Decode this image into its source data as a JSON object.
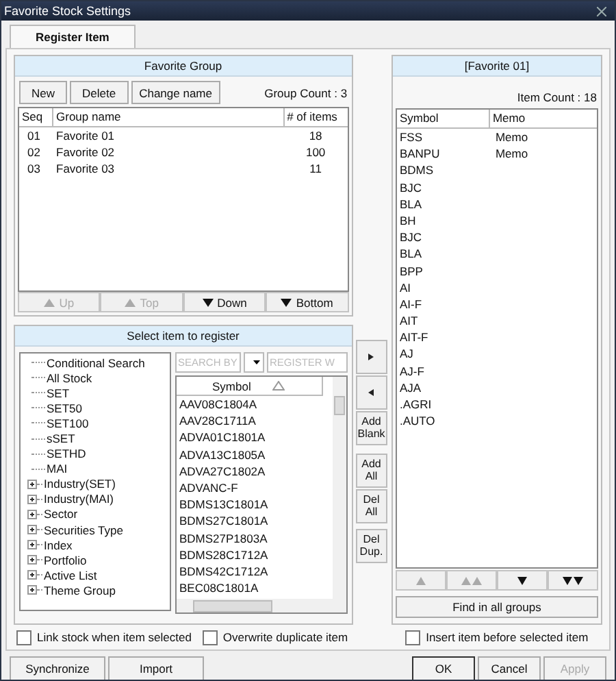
{
  "window": {
    "title": "Favorite Stock Settings"
  },
  "tabs": [
    {
      "label": "Register Item",
      "selected": true
    }
  ],
  "favorite_group": {
    "title": "Favorite Group",
    "buttons": [
      "New",
      "Delete",
      "Change name"
    ],
    "group_count": "Group Count : 3",
    "columns": [
      "Seq",
      "Group name",
      "# of items"
    ],
    "rows": [
      {
        "seq": "01",
        "name": "Favorite 01",
        "items": "18"
      },
      {
        "seq": "02",
        "name": "Favorite 02",
        "items": "100"
      },
      {
        "seq": "03",
        "name": "Favorite 03",
        "items": "11"
      }
    ],
    "move_buttons": [
      {
        "label": "Up",
        "kind": "up",
        "disabled": true
      },
      {
        "label": "Top",
        "kind": "up",
        "disabled": true
      },
      {
        "label": "Down",
        "kind": "down",
        "disabled": false
      },
      {
        "label": "Bottom",
        "kind": "down",
        "disabled": false
      }
    ]
  },
  "select_panel": {
    "title": "Select item to register",
    "tree": [
      {
        "label": "Conditional Search",
        "kind": "leaf"
      },
      {
        "label": "All Stock",
        "kind": "leaf"
      },
      {
        "label": "SET",
        "kind": "leaf"
      },
      {
        "label": "SET50",
        "kind": "leaf"
      },
      {
        "label": "SET100",
        "kind": "leaf"
      },
      {
        "label": "sSET",
        "kind": "leaf"
      },
      {
        "label": "SETHD",
        "kind": "leaf"
      },
      {
        "label": "MAI",
        "kind": "leaf"
      },
      {
        "label": "Industry(SET)",
        "kind": "group",
        "expanded": false
      },
      {
        "label": "Industry(MAI)",
        "kind": "group",
        "expanded": false
      },
      {
        "label": "Sector",
        "kind": "group",
        "expanded": false
      },
      {
        "label": "Securities Type",
        "kind": "group",
        "expanded": false
      },
      {
        "label": "Index",
        "kind": "group",
        "expanded": false
      },
      {
        "label": "Portfolio",
        "kind": "group",
        "expanded": false
      },
      {
        "label": "Active List",
        "kind": "group",
        "expanded": false
      },
      {
        "label": "Theme Group",
        "kind": "group",
        "expanded": false
      }
    ],
    "search_field": {
      "placeholder": "SEARCH BY"
    },
    "register_field": {
      "placeholder": "REGISTER W"
    },
    "symbol_column": "Symbol",
    "symbols": [
      "AAV08C1804A",
      "AAV28C1711A",
      "ADVA01C1801A",
      "ADVA13C1805A",
      "ADVA27C1802A",
      "ADVANC-F",
      "BDMS13C1801A",
      "BDMS27C1801A",
      "BDMS27P1803A",
      "BDMS28C1712A",
      "BDMS42C1712A",
      "BEC08C1801A"
    ]
  },
  "transfer_buttons": [
    {
      "kind": "right"
    },
    {
      "kind": "left"
    },
    {
      "kind": "text",
      "label": "Add Blank"
    },
    {
      "kind": "text",
      "label": "Add All"
    },
    {
      "kind": "text",
      "label": "Del All"
    },
    {
      "kind": "text",
      "label": "Del Dup."
    }
  ],
  "favorite_items": {
    "title": "[Favorite 01]",
    "item_count": "Item Count : 18",
    "columns": [
      "Symbol",
      "Memo"
    ],
    "rows": [
      {
        "symbol": "FSS",
        "memo": "Memo"
      },
      {
        "symbol": "BANPU",
        "memo": "Memo"
      },
      {
        "symbol": "BDMS"
      },
      {
        "symbol": "BJC"
      },
      {
        "symbol": "BLA"
      },
      {
        "symbol": "BH"
      },
      {
        "symbol": "BJC"
      },
      {
        "symbol": "BLA"
      },
      {
        "symbol": "BPP"
      },
      {
        "symbol": "AI"
      },
      {
        "symbol": "AI-F"
      },
      {
        "symbol": "AIT"
      },
      {
        "symbol": "AIT-F"
      },
      {
        "symbol": "AJ"
      },
      {
        "symbol": "AJ-F"
      },
      {
        "symbol": "AJA"
      },
      {
        "symbol": ".AGRI"
      },
      {
        "symbol": ".AUTO"
      }
    ],
    "move_buttons": [
      {
        "kind": "up",
        "disabled": true
      },
      {
        "kind": "top",
        "disabled": true
      },
      {
        "kind": "down",
        "disabled": false
      },
      {
        "kind": "bottom",
        "disabled": false
      }
    ],
    "find_button": "Find in all groups"
  },
  "options": [
    {
      "label": "Link stock when item selected",
      "checked": false
    },
    {
      "label": "Overwrite duplicate item",
      "checked": false
    },
    {
      "label": "Insert item before selected item",
      "checked": false
    }
  ],
  "footer_left": [
    "Synchronize",
    "Import"
  ],
  "footer_right": [
    {
      "label": "OK",
      "disabled": false
    },
    {
      "label": "Cancel",
      "disabled": false
    },
    {
      "label": "Apply",
      "disabled": true
    }
  ]
}
